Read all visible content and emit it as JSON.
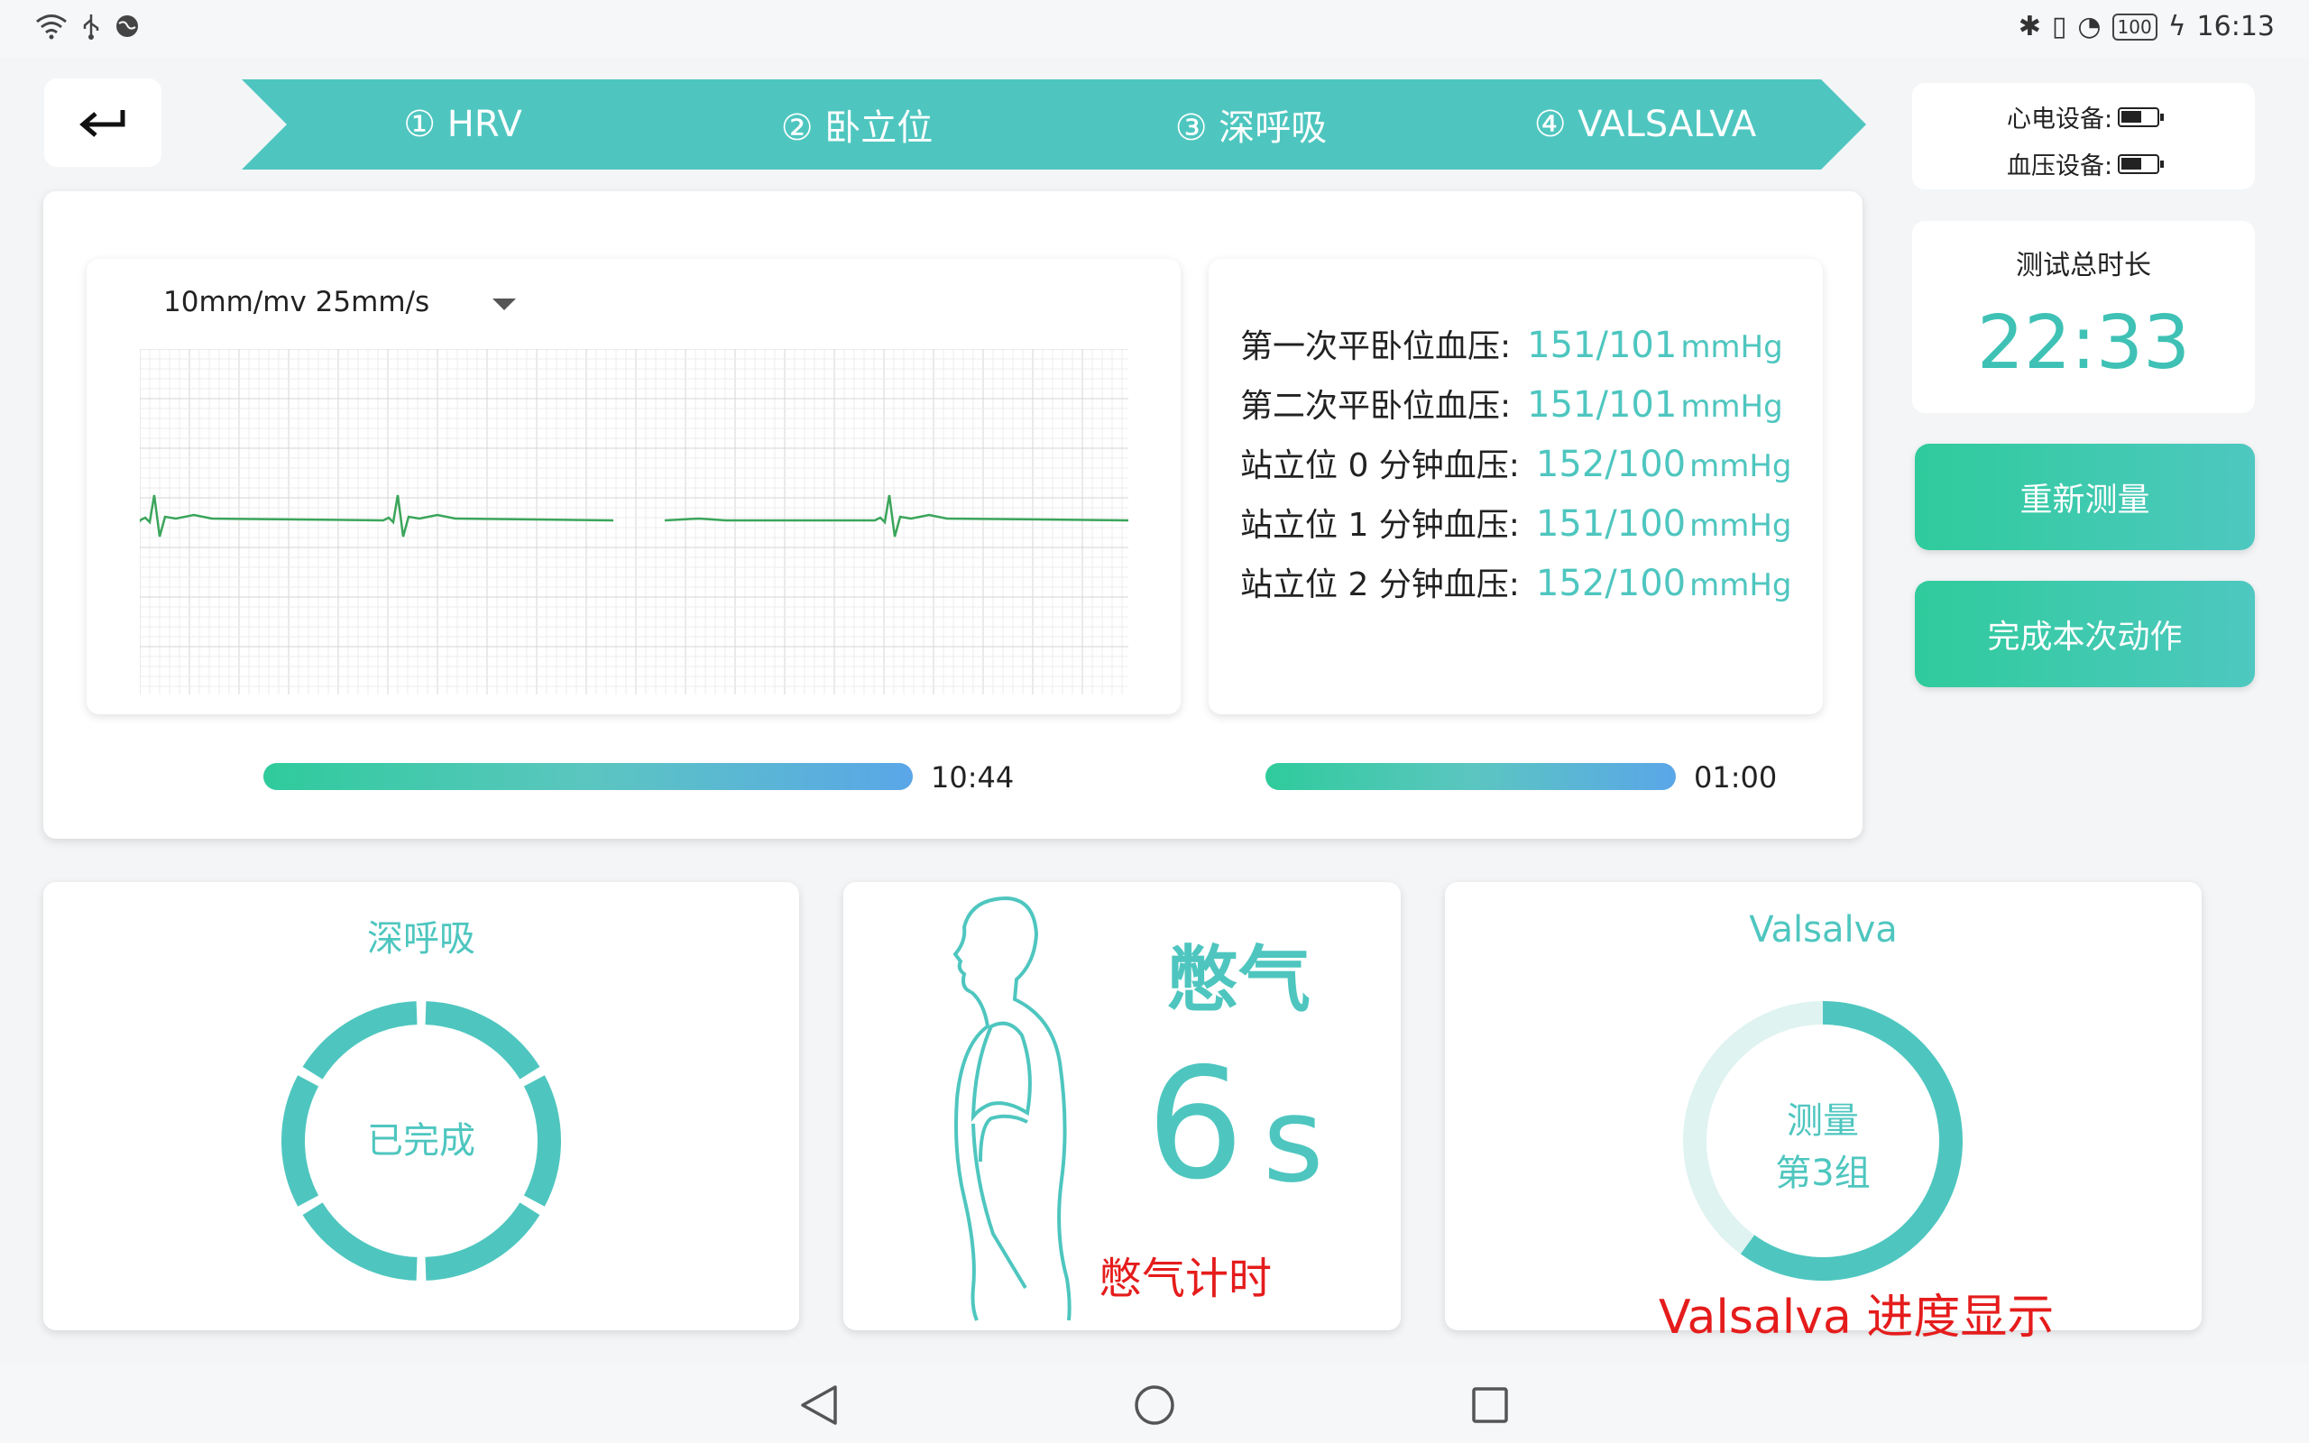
{
  "status": {
    "battery": "100",
    "time": "16:13",
    "icons": [
      "wifi-icon",
      "usb-icon",
      "globe-icon",
      "bluetooth-icon",
      "vibrate-icon",
      "speed-icon",
      "charging-icon"
    ]
  },
  "steps": [
    {
      "label": "① HRV"
    },
    {
      "label": "② 卧立位"
    },
    {
      "label": "③ 深呼吸"
    },
    {
      "label": "④ VALSALVA"
    }
  ],
  "ecg": {
    "speed": "10mm/mv 25mm/s"
  },
  "bp": [
    {
      "label": "第一次平卧位血压:",
      "value": "151/101",
      "unit": "mmHg"
    },
    {
      "label": "第二次平卧位血压:",
      "value": "151/101",
      "unit": "mmHg"
    },
    {
      "label": "站立位 0 分钟血压:",
      "value": "152/100",
      "unit": "mmHg"
    },
    {
      "label": "站立位 1 分钟血压:",
      "value": "151/100",
      "unit": "mmHg"
    },
    {
      "label": "站立位 2 分钟血压:",
      "value": "152/100",
      "unit": "mmHg"
    }
  ],
  "progress": [
    {
      "time": "10:44",
      "fraction": 1.0
    },
    {
      "time": "01:00",
      "fraction": 1.0
    }
  ],
  "devices": {
    "ecg_label": "心电设备:",
    "bp_label": "血压设备:"
  },
  "duration": {
    "title": "测试总时长",
    "time": "22:33"
  },
  "buttons": {
    "remeasure": "重新测量",
    "finish": "完成本次动作"
  },
  "deep_breath": {
    "title": "深呼吸",
    "status": "已完成",
    "segments_done": 6,
    "segments_total": 6
  },
  "breath_hold": {
    "title": "憋气",
    "count": "6",
    "unit": "s",
    "note": "憋气计时"
  },
  "valsalva": {
    "title": "Valsalva",
    "line1": "测量",
    "line2": "第3组",
    "progress": 0.6,
    "note": "Valsalva 进度显示"
  },
  "colors": {
    "accent": "#4ec6bf",
    "step": "#4ec6bf",
    "alert": "#e51c1c"
  }
}
